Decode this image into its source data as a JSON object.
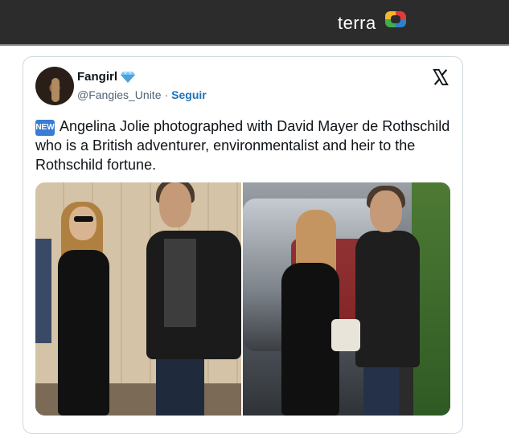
{
  "header": {
    "brand_text": "terra",
    "brand_icon": "terra-logo-icon",
    "background_color": "#2c2c2c"
  },
  "tweet": {
    "author_name": "Fangirl",
    "verified_icon": "diamond-icon",
    "handle": "@Fangies_Unite",
    "separator": "·",
    "follow_label": "Seguir",
    "platform_icon": "x-logo-icon",
    "new_badge": "NEW",
    "text": "Angelina Jolie photographed with David Mayer de Rothschild who is a British adventurer, environmentalist and heir to the Rothschild fortune.",
    "accent_color": "#1d72b8"
  }
}
